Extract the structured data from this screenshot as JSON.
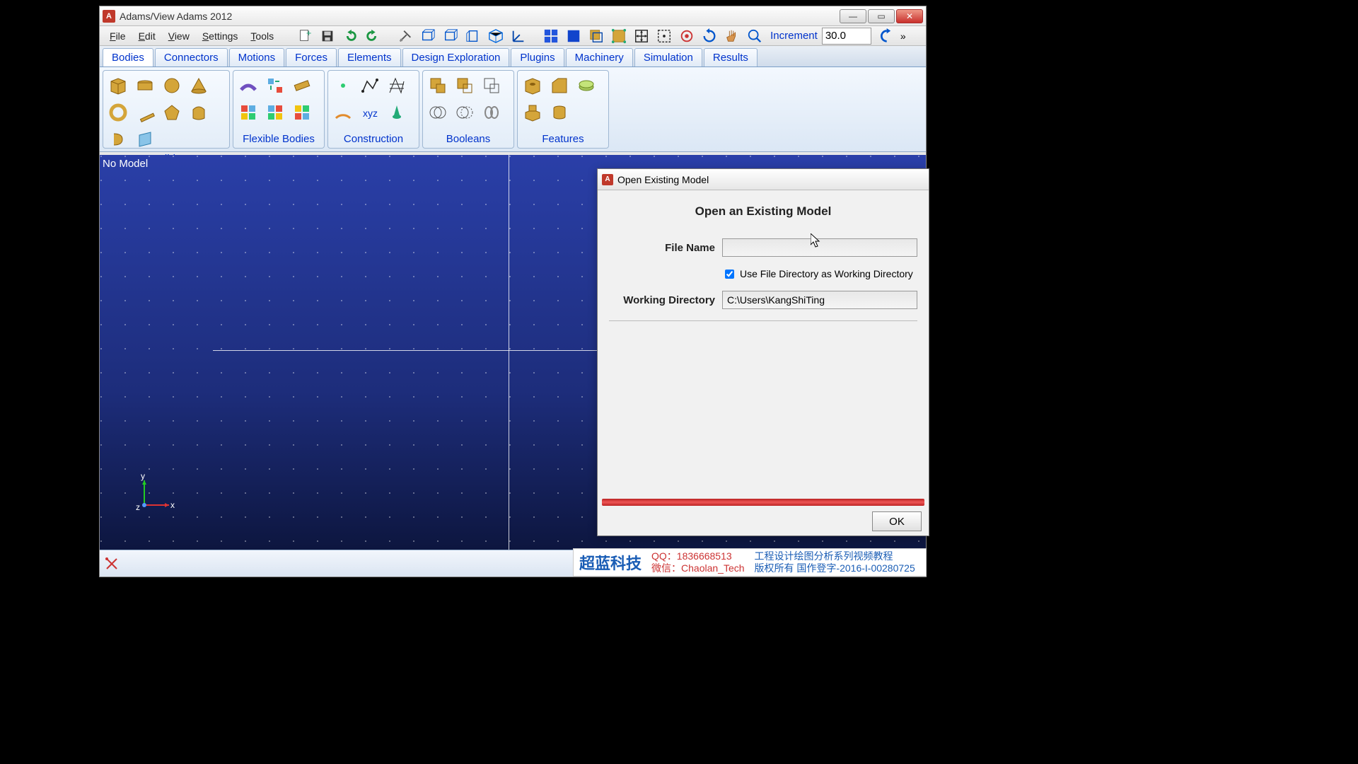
{
  "window": {
    "title": "Adams/View Adams 2012"
  },
  "menu": {
    "file": "File",
    "edit": "Edit",
    "view": "View",
    "settings": "Settings",
    "tools": "Tools"
  },
  "toolbar": {
    "increment_label": "Increment",
    "increment_value": "30.0"
  },
  "tabs": [
    "Bodies",
    "Connectors",
    "Motions",
    "Forces",
    "Elements",
    "Design Exploration",
    "Plugins",
    "Machinery",
    "Simulation",
    "Results"
  ],
  "ribbon_groups": {
    "solids": "Solids",
    "flexible": "Flexible Bodies",
    "construction": "Construction",
    "booleans": "Booleans",
    "features": "Features"
  },
  "viewport": {
    "no_model": "No Model",
    "axes": {
      "x": "x",
      "y": "y",
      "z": "z"
    }
  },
  "dialog": {
    "title": "Open Existing Model",
    "heading": "Open an Existing Model",
    "file_name_label": "File Name",
    "file_name_value": "",
    "use_dir_label": "Use File Directory as Working Directory",
    "working_dir_label": "Working Directory",
    "working_dir_value": "C:\\Users\\KangShiTing",
    "ok": "OK"
  },
  "overlay": {
    "brand": "超蓝科技",
    "qq_line1": "QQ：1836668513",
    "qq_line2": "微信：Chaolan_Tech",
    "desc_line1": "工程设计绘图分析系列视频教程",
    "desc_line2": "版权所有  国作登字-2016-I-00280725"
  }
}
